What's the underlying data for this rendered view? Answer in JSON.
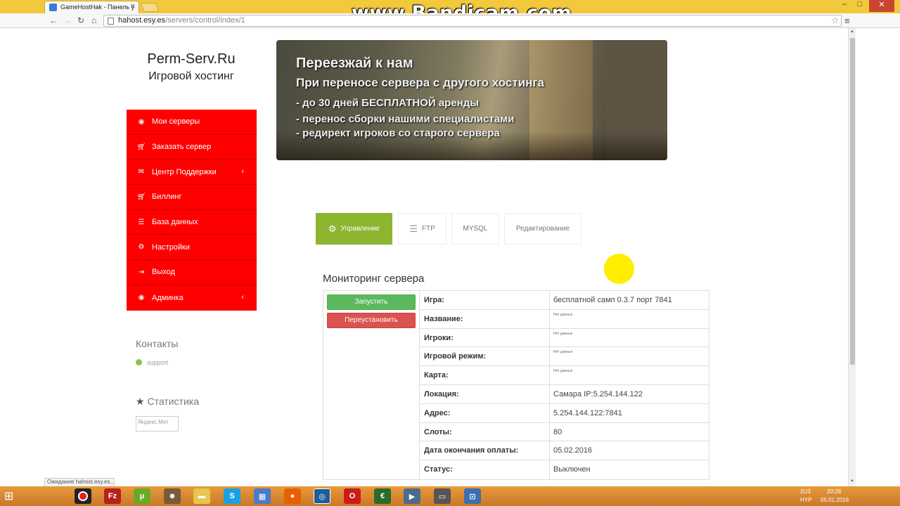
{
  "browser": {
    "tab_title": "GameHostHak - Панель у",
    "url_host": "hahost.esy.es",
    "url_path": "/servers/control/index/1",
    "watermark": "www.Bandicam.com",
    "status_text": "Ожидание hahost.esy.es..."
  },
  "brand": {
    "name": "Perm-Serv.Ru",
    "subtitle": "Игровой хостинг"
  },
  "sidebar": {
    "items": [
      {
        "label": "Мои серверы",
        "icon": "gamepad-icon"
      },
      {
        "label": "Заказать сервер",
        "icon": "cart-icon"
      },
      {
        "label": "Центр Поддержки",
        "icon": "comments-icon"
      },
      {
        "label": "Биллинг",
        "icon": "cart-icon"
      },
      {
        "label": "База данных",
        "icon": "database-icon"
      },
      {
        "label": "Настройки",
        "icon": "gear-icon"
      },
      {
        "label": "Выход",
        "icon": "logout-icon"
      },
      {
        "label": "Админка",
        "icon": "circle-dot-icon"
      }
    ],
    "contacts_title": "Контакты",
    "skype": "support",
    "stats_title": "Статистика",
    "yandex_alt": "Яндекс.Мет"
  },
  "banner": {
    "line1": "Переезжай к нам",
    "line2": "При переносе сервера с другого хостинга",
    "line3": "- до 30 дней БЕСПЛАТНОЙ аренды",
    "line4": "- перенос сборки нашими специалистами",
    "line5": "- редирект игроков со старого сервера"
  },
  "tabs": [
    {
      "label": "Управление",
      "active": true
    },
    {
      "label": "FTP",
      "active": false
    },
    {
      "label": "MYSQL",
      "active": false
    },
    {
      "label": "Редактирование",
      "active": false
    }
  ],
  "monitor": {
    "title": "Мониторинг сервера",
    "start_button": "Запустить",
    "reinstall_button": "Переустановить",
    "rows": [
      {
        "label": "Игра:",
        "value": "бесплатной самп 0.3.7 порт 7841"
      },
      {
        "label": "Название:",
        "value": "Нет данных"
      },
      {
        "label": "Игроки:",
        "value": "Нет данных"
      },
      {
        "label": "Игровой режим:",
        "value": "Нет данных"
      },
      {
        "label": "Карта:",
        "value": "Нет данных"
      },
      {
        "label": "Локация:",
        "value": "Самара IP:5.254.144.122"
      },
      {
        "label": "Адрес:",
        "value": "5.254.144.122:7841"
      },
      {
        "label": "Слоты:",
        "value": "80"
      },
      {
        "label": "Дата окончания оплаты:",
        "value": "05.02.2016"
      },
      {
        "label": "Статус:",
        "value": "Выключен"
      }
    ]
  },
  "taskbar": {
    "time": "20:28",
    "date": "05.01.2016",
    "lang": "HYP",
    "tray_label": "2U3"
  },
  "colors": {
    "sidebar_red": "#ff0000",
    "active_tab_green": "#8cb530",
    "start_green": "#5cb85c",
    "reinstall_red": "#d9534f"
  }
}
